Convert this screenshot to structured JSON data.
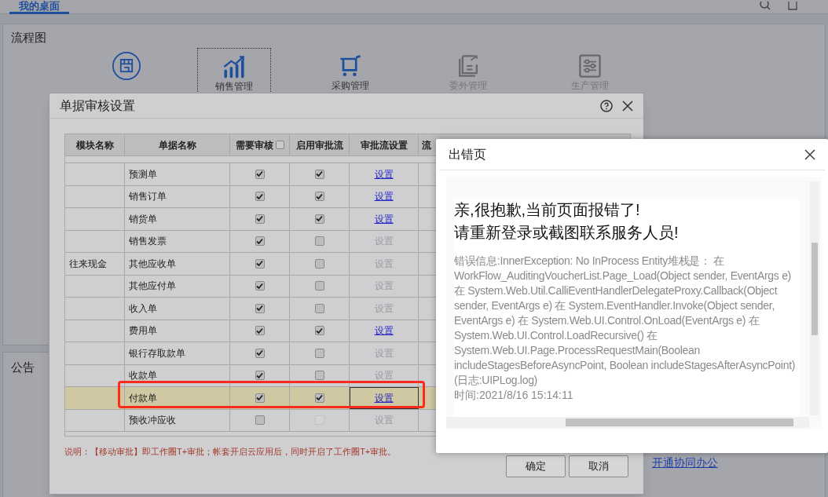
{
  "top_tab": {
    "label": "我的桌面",
    "selected": true
  },
  "flow_panel": {
    "title": "流程图",
    "items": [
      {
        "selected": false,
        "enabled": true
      },
      {
        "label": "销售管理",
        "selected": true,
        "enabled": true
      },
      {
        "label": "采购管理",
        "selected": false,
        "enabled": true
      },
      {
        "label": "委外管理",
        "selected": false,
        "enabled": false
      },
      {
        "label": "生产管理",
        "selected": false,
        "enabled": false
      }
    ]
  },
  "notice_panel": {
    "title": "公告",
    "link": "开通协同办公"
  },
  "audit_dialog": {
    "title": "单据审核设置",
    "columns": [
      "模块名称",
      "单据名称",
      "需要审核",
      "启用审批流",
      "审批流设置",
      "流"
    ],
    "select_all_checked": false,
    "rows": [
      {
        "name": "预测单",
        "needs_review": true,
        "approval_flow": true,
        "flow_disabled": false,
        "setting": "设置",
        "selected": false
      },
      {
        "name": "销售订单",
        "needs_review": true,
        "approval_flow": true,
        "flow_disabled": false,
        "setting": "设置",
        "selected": false
      },
      {
        "name": "销货单",
        "needs_review": true,
        "approval_flow": true,
        "flow_disabled": false,
        "setting": "设置",
        "selected": false
      },
      {
        "name": "销售发票",
        "needs_review": true,
        "approval_flow": false,
        "flow_disabled": false,
        "setting": "设置",
        "selected": false
      },
      {
        "module": "往来现金",
        "name": "其他应收单",
        "needs_review": true,
        "approval_flow": false,
        "flow_disabled": false,
        "setting": "设置",
        "selected": false
      },
      {
        "name": "其他应付单",
        "needs_review": true,
        "approval_flow": false,
        "flow_disabled": false,
        "setting": "设置",
        "selected": false
      },
      {
        "name": "收入单",
        "needs_review": true,
        "approval_flow": false,
        "flow_disabled": false,
        "setting": "设置",
        "selected": false
      },
      {
        "name": "费用单",
        "needs_review": true,
        "approval_flow": true,
        "flow_disabled": false,
        "setting": "设置",
        "selected": false
      },
      {
        "name": "银行存取款单",
        "needs_review": true,
        "approval_flow": false,
        "flow_disabled": false,
        "setting": "设置",
        "selected": false
      },
      {
        "name": "收款单",
        "needs_review": true,
        "approval_flow": false,
        "flow_disabled": false,
        "setting": "设置",
        "selected": false
      },
      {
        "name": "付款单",
        "needs_review": true,
        "approval_flow": true,
        "flow_disabled": false,
        "setting": "设置",
        "selected": true
      },
      {
        "name": "预收冲应收",
        "needs_review": false,
        "approval_flow": false,
        "flow_disabled": true,
        "setting": "设置",
        "selected": false
      }
    ],
    "note": "说明：【移动审批】即工作圈T+审批；帐套开启云应用后，同时开启了工作圈T+审批。",
    "buttons": [
      "确定",
      "取消"
    ]
  },
  "error_dialog": {
    "title": "出错页",
    "headline": [
      "亲,很抱歉,当前页面报错了!",
      "请重新登录或截图联系服务人员!"
    ],
    "detail": "错误信息:InnerException: No InProcess Entity堆栈是：  在 WorkFlow_AuditingVoucherList.Page_Load(Object sender, EventArgs e) 在 System.Web.Util.CalliEventHandlerDelegateProxy.Callback(Object sender, EventArgs e) 在 System.EventHandler.Invoke(Object sender, EventArgs e) 在 System.Web.UI.Control.OnLoad(EventArgs e) 在 System.Web.UI.Control.LoadRecursive() 在 System.Web.UI.Page.ProcessRequestMain(Boolean includeStagesBeforeAsyncPoint, Boolean includeStagesAfterAsyncPoint)(日志:UIPLog.log)",
    "time": "时间:2021/8/16 15:14:11"
  }
}
